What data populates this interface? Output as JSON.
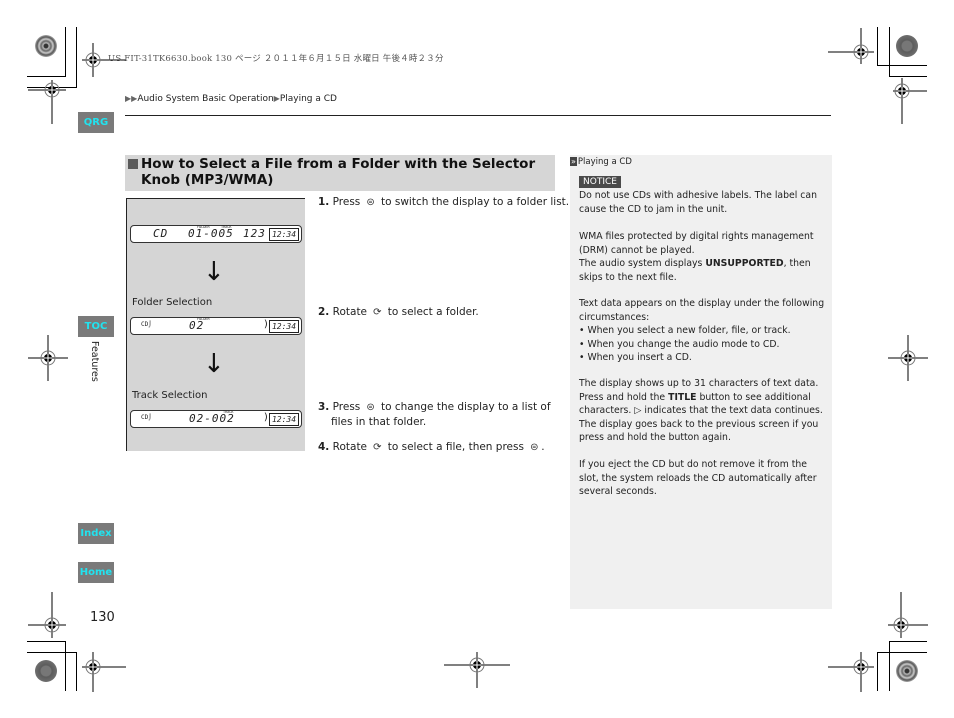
{
  "print_header": "US FIT-31TK6630.book  130 ページ  ２０１１年６月１５日  水曜日  午後４時２３分",
  "breadcrumb": {
    "prefix": "▶▶",
    "items": [
      "Audio System Basic Operation",
      "Playing a CD"
    ],
    "separator": "▶"
  },
  "side_nav": {
    "qrg": "QRG",
    "toc": "TOC",
    "index": "Index",
    "home": "Home",
    "section_label": "Features",
    "accent_color": "#21e3ef",
    "button_color": "#7a7a7a"
  },
  "page_number": "130",
  "section": {
    "title": "How to Select a File from a Folder with the Selector Knob (MP3/WMA)"
  },
  "diagram": {
    "displays": [
      {
        "mode": "CD",
        "folder_label": "FOLDER",
        "track_label": "TRACK",
        "value": "01-005",
        "extra": "123",
        "clock": "12:34"
      },
      {
        "mode": "CD",
        "folder_label": "FOLDER",
        "value": "02",
        "clock": "12:34"
      },
      {
        "mode": "CD",
        "track_label": "TRACK",
        "value": "02-002",
        "clock": "12:34"
      }
    ],
    "labels": [
      "Folder Selection",
      "Track Selection"
    ],
    "arrow": "↓"
  },
  "steps": [
    {
      "num": "1.",
      "pre": "Press",
      "icon": "press-knob",
      "post": "to switch the display to a folder list."
    },
    {
      "num": "2.",
      "pre": "Rotate",
      "icon": "rotate-knob",
      "post": "to select a folder."
    },
    {
      "num": "3.",
      "pre": "Press",
      "icon": "press-knob",
      "post": "to change the display to a list of",
      "cont": "files in that folder."
    },
    {
      "num": "4.",
      "pre": "Rotate",
      "icon": "rotate-knob",
      "post": "to select a file, then press",
      "post2": "."
    }
  ],
  "notes": {
    "ref_title": "Playing a CD",
    "notice_label": "NOTICE",
    "notice_text": "Do not use CDs with adhesive labels. The label can cause the CD to jam in the unit.",
    "drm_text": "WMA files protected by digital rights management (DRM) cannot be played.",
    "unsupported_pre": "The audio system displays ",
    "unsupported_bold": "UNSUPPORTED",
    "unsupported_post": ", then skips to the next file.",
    "text_data_intro": "Text data appears on the display under the following circumstances:",
    "bullets": [
      "When you select a new folder, file, or track.",
      "When you change the audio mode to CD.",
      "When you insert a CD."
    ],
    "display_p1": "The display shows up to 31 characters of text data. Press and hold the ",
    "display_bold": "TITLE",
    "display_p2": " button to see additional characters. ",
    "display_symbol": "▷",
    "display_p3": " indicates that the text data continues. The display goes back to the previous screen if you press and hold the button again.",
    "eject_text": "If you eject the CD but do not remove it from the slot, the system reloads the CD automatically after several seconds."
  }
}
